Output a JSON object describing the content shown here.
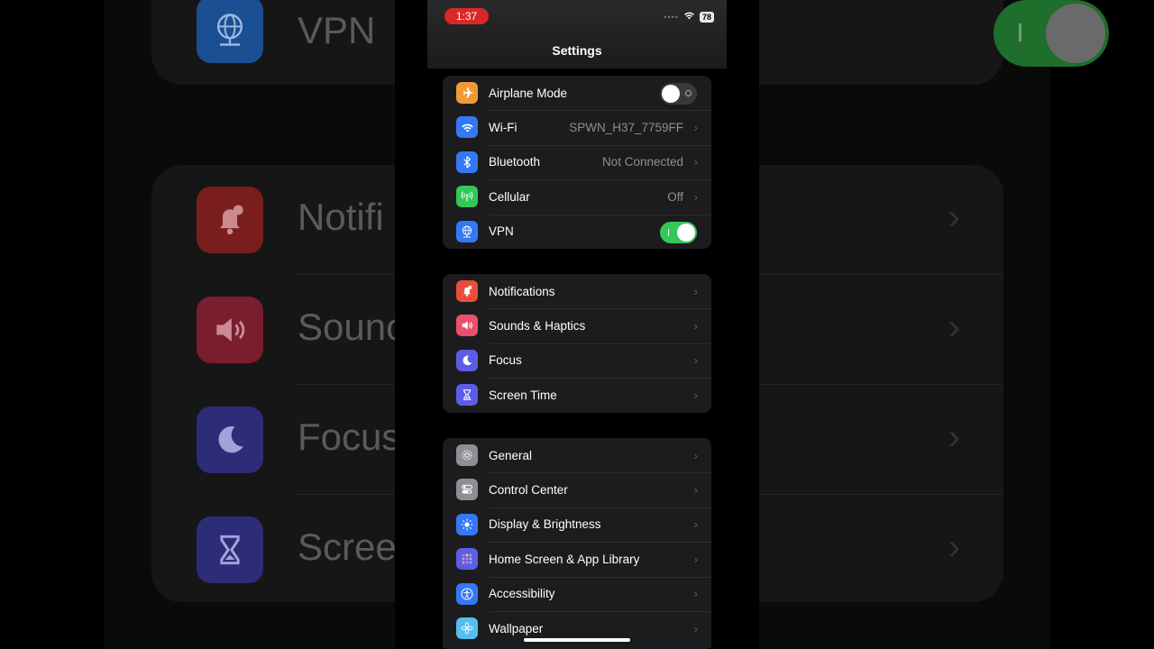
{
  "status": {
    "time": "1:37",
    "battery": "78"
  },
  "nav": {
    "title": "Settings"
  },
  "background": {
    "vpn_label": "VPN",
    "notifications_label": "Notifi",
    "sounds_label": "Sounc",
    "focus_label": "Focus",
    "screen_label": "Scree"
  },
  "groups": [
    {
      "rows": [
        {
          "label": "Airplane Mode",
          "icon": "airplane-icon",
          "color": "#f09a37",
          "toggle": "off"
        },
        {
          "label": "Wi-Fi",
          "icon": "wifi-icon",
          "color": "#3478f6",
          "value": "SPWN_H37_7759FF"
        },
        {
          "label": "Bluetooth",
          "icon": "bluetooth-icon",
          "color": "#3478f6",
          "value": "Not Connected"
        },
        {
          "label": "Cellular",
          "icon": "cellular-icon",
          "color": "#34c759",
          "value": "Off"
        },
        {
          "label": "VPN",
          "icon": "vpn-globe-icon",
          "color": "#3478f6",
          "toggle": "on"
        }
      ]
    },
    {
      "rows": [
        {
          "label": "Notifications",
          "icon": "bell-icon",
          "color": "#eb4d3d"
        },
        {
          "label": "Sounds & Haptics",
          "icon": "speaker-icon",
          "color": "#eb4e6e"
        },
        {
          "label": "Focus",
          "icon": "moon-icon",
          "color": "#5e5ce6"
        },
        {
          "label": "Screen Time",
          "icon": "hourglass-icon",
          "color": "#5e5ce6"
        }
      ]
    },
    {
      "rows": [
        {
          "label": "General",
          "icon": "gear-icon",
          "color": "#8e8e93"
        },
        {
          "label": "Control Center",
          "icon": "switches-icon",
          "color": "#8e8e93"
        },
        {
          "label": "Display & Brightness",
          "icon": "sun-icon",
          "color": "#3478f6"
        },
        {
          "label": "Home Screen & App Library",
          "icon": "app-grid-icon",
          "color": "#5e5ce6"
        },
        {
          "label": "Accessibility",
          "icon": "accessibility-icon",
          "color": "#3478f6"
        },
        {
          "label": "Wallpaper",
          "icon": "flower-icon",
          "color": "#55bef0"
        }
      ]
    }
  ]
}
